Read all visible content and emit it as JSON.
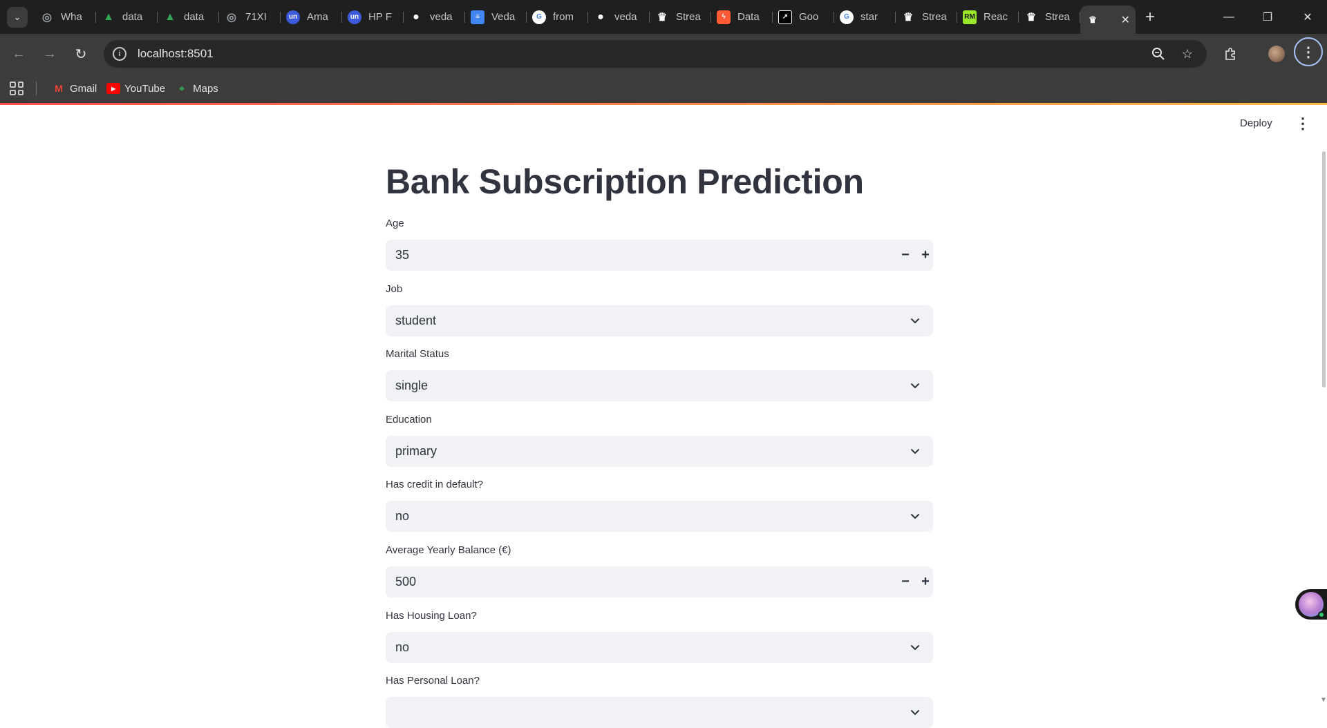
{
  "browser": {
    "tabs": [
      {
        "label": "Wha",
        "icon": "chrome-icon",
        "color": "#9aa0a6"
      },
      {
        "label": "data",
        "icon": "google-drive-icon",
        "color": "#34a853"
      },
      {
        "label": "data",
        "icon": "google-drive-icon",
        "color": "#34a853"
      },
      {
        "label": "71XI",
        "icon": "chrome-icon",
        "color": "#9aa0a6"
      },
      {
        "label": "Ama",
        "icon": "unstop-icon",
        "color": "#3b5bdb"
      },
      {
        "label": "HP F",
        "icon": "unstop-icon",
        "color": "#3b5bdb"
      },
      {
        "label": "veda",
        "icon": "github-icon",
        "color": "#ffffff"
      },
      {
        "label": "Veda",
        "icon": "google-docs-icon",
        "color": "#4285f4"
      },
      {
        "label": "from",
        "icon": "google-icon",
        "color": "#4285f4"
      },
      {
        "label": "veda",
        "icon": "github-icon",
        "color": "#ffffff"
      },
      {
        "label": "Strea",
        "icon": "streamlit-icon",
        "color": "#ffffff"
      },
      {
        "label": "Data",
        "icon": "lightning-icon",
        "color": "#ff5a36"
      },
      {
        "label": "Goo",
        "icon": "external-link-icon",
        "color": "#ffffff"
      },
      {
        "label": "star",
        "icon": "google-icon",
        "color": "#4285f4"
      },
      {
        "label": "Strea",
        "icon": "streamlit-icon",
        "color": "#ffffff"
      },
      {
        "label": "Reac",
        "icon": "rm-icon",
        "color": "#9ae62a"
      },
      {
        "label": "Strea",
        "icon": "streamlit-icon",
        "color": "#ffffff"
      }
    ],
    "active_tab_icon": "streamlit-icon",
    "url": "localhost:8501",
    "bookmarks": [
      {
        "label": "Gmail",
        "icon": "gmail-icon",
        "color": "#ea4335"
      },
      {
        "label": "YouTube",
        "icon": "youtube-icon",
        "color": "#ff0000"
      },
      {
        "label": "Maps",
        "icon": "maps-icon",
        "color": "#34a853"
      }
    ]
  },
  "header": {
    "deploy_label": "Deploy"
  },
  "main": {
    "title": "Bank Subscription Prediction",
    "fields": [
      {
        "label": "Age",
        "type": "number",
        "value": "35"
      },
      {
        "label": "Job",
        "type": "select",
        "value": "student"
      },
      {
        "label": "Marital Status",
        "type": "select",
        "value": "single"
      },
      {
        "label": "Education",
        "type": "select",
        "value": "primary"
      },
      {
        "label": "Has credit in default?",
        "type": "select",
        "value": "no"
      },
      {
        "label": "Average Yearly Balance (€)",
        "type": "number",
        "value": "500"
      },
      {
        "label": "Has Housing Loan?",
        "type": "select",
        "value": "no"
      },
      {
        "label": "Has Personal Loan?",
        "type": "select",
        "value": ""
      }
    ],
    "stepper": {
      "minus": "−",
      "plus": "+"
    }
  }
}
